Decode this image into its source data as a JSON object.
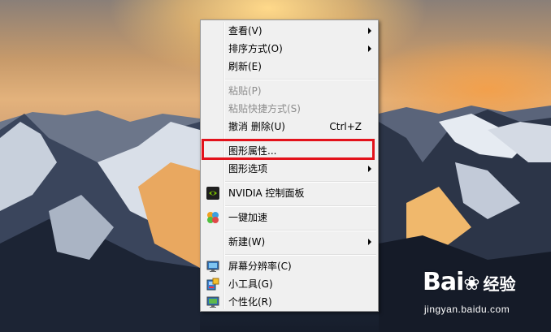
{
  "menu": {
    "items": [
      {
        "label": "查看(V)",
        "submenu": true
      },
      {
        "label": "排序方式(O)",
        "submenu": true
      },
      {
        "label": "刷新(E)"
      },
      {
        "label": "粘贴(P)",
        "disabled": true
      },
      {
        "label": "粘贴快捷方式(S)",
        "disabled": true
      },
      {
        "label": "撤消 删除(U)",
        "shortcut": "Ctrl+Z"
      },
      {
        "label": "图形属性..."
      },
      {
        "label": "图形选项",
        "submenu": true
      },
      {
        "label": "NVIDIA 控制面板",
        "icon": "nvidia-icon"
      },
      {
        "label": "一键加速",
        "icon": "accelerate-icon"
      },
      {
        "label": "新建(W)",
        "submenu": true
      },
      {
        "label": "屏幕分辨率(C)",
        "icon": "monitor-icon"
      },
      {
        "label": "小工具(G)",
        "icon": "gadgets-icon"
      },
      {
        "label": "个性化(R)",
        "icon": "personalize-icon"
      }
    ]
  },
  "highlight_color": "#e3121b",
  "watermark": {
    "logo": "Bai",
    "logo_suffix": "经验",
    "site": "jingyan.baidu.com"
  }
}
